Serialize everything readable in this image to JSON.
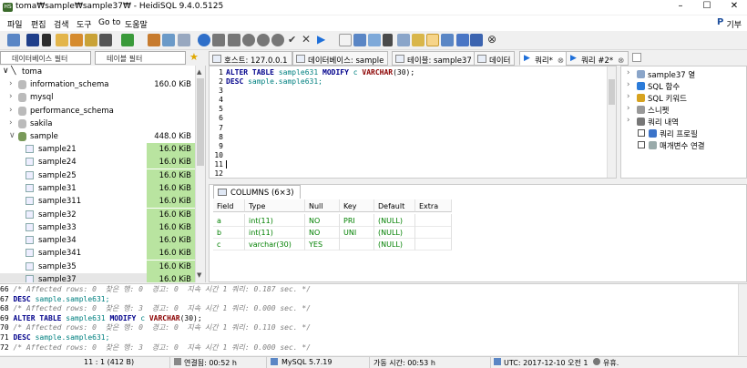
{
  "window": {
    "title": "toma₩sample₩sample37₩ - HeidiSQL 9.4.0.5125"
  },
  "menu": {
    "items": [
      "파일",
      "편집",
      "검색",
      "도구",
      "Go to",
      "도움말"
    ],
    "donate": "기부"
  },
  "filters": {
    "db_placeholder": "데이터베이스 필터",
    "table_placeholder": "테이블 필터"
  },
  "tabs": [
    "호스트: 127.0.0.1",
    "데이터베이스: sample",
    "테이블: sample37",
    "데이터",
    "쿼리*",
    "쿼리 #2*"
  ],
  "tree": {
    "root": "toma",
    "databases": [
      {
        "name": "information_schema",
        "size": "160.0 KiB"
      },
      {
        "name": "mysql",
        "size": ""
      },
      {
        "name": "performance_schema",
        "size": ""
      },
      {
        "name": "sakila",
        "size": ""
      },
      {
        "name": "sample",
        "size": "448.0 KiB"
      }
    ],
    "tables": [
      {
        "name": "sample21",
        "size": "16.0 KiB"
      },
      {
        "name": "sample24",
        "size": "16.0 KiB"
      },
      {
        "name": "sample25",
        "size": "16.0 KiB"
      },
      {
        "name": "sample31",
        "size": "16.0 KiB"
      },
      {
        "name": "sample311",
        "size": "16.0 KiB"
      },
      {
        "name": "sample32",
        "size": "16.0 KiB"
      },
      {
        "name": "sample33",
        "size": "16.0 KiB"
      },
      {
        "name": "sample34",
        "size": "16.0 KiB"
      },
      {
        "name": "sample341",
        "size": "16.0 KiB"
      },
      {
        "name": "sample35",
        "size": "16.0 KiB"
      },
      {
        "name": "sample37",
        "size": "16.0 KiB"
      }
    ]
  },
  "editor": {
    "line_numbers": [
      "1",
      "2",
      "3",
      "4",
      "5",
      "6",
      "7",
      "8",
      "9",
      "10",
      "11",
      "12"
    ],
    "line1": {
      "kw1": "ALTER TABLE",
      "ident": "sample631",
      "kw2": "MODIFY",
      "col": "c",
      "type": "VARCHAR",
      "arg": "(30);"
    },
    "line2": {
      "kw": "DESC",
      "ident": "sample.sample631;"
    }
  },
  "helper": {
    "items": [
      "sample37 열",
      "SQL 함수",
      "SQL 키워드",
      "스니펫",
      "쿼리 내역",
      "쿼리 프로필",
      "매개변수 연결"
    ]
  },
  "results": {
    "tab_label": "COLUMNS (6×3)",
    "headers": [
      "Field",
      "Type",
      "Null",
      "Key",
      "Default",
      "Extra"
    ],
    "rows": [
      [
        "a",
        "int(11)",
        "NO",
        "PRI",
        "(NULL)",
        ""
      ],
      [
        "b",
        "int(11)",
        "NO",
        "UNI",
        "(NULL)",
        ""
      ],
      [
        "c",
        "varchar(30)",
        "YES",
        "",
        "(NULL)",
        ""
      ]
    ]
  },
  "log": {
    "lines": [
      {
        "n": "66",
        "type": "comment",
        "text": "/* Affected rows: 0  찾은 행: 0  경고: 0  지속 시간 1 쿼리: 0.187 sec. */"
      },
      {
        "n": "67",
        "type": "sql",
        "kw": "DESC",
        "rest": "sample.sample631;"
      },
      {
        "n": "68",
        "type": "comment",
        "text": "/* Affected rows: 0  찾은 행: 3  경고: 0  지속 시간 1 쿼리: 0.000 sec. */"
      },
      {
        "n": "69",
        "type": "alter",
        "kw": "ALTER TABLE",
        "ident": "sample631",
        "kw2": "MODIFY",
        "col": "c",
        "fn": "VARCHAR",
        "arg": "(30);"
      },
      {
        "n": "70",
        "type": "comment",
        "text": "/* Affected rows: 0  찾은 행: 0  경고: 0  지속 시간 1 쿼리: 0.110 sec. */"
      },
      {
        "n": "71",
        "type": "sql",
        "kw": "DESC",
        "rest": "sample.sample631;"
      },
      {
        "n": "72",
        "type": "comment",
        "text": "/* Affected rows: 0  찾은 행: 3  경고: 0  지속 시간 1 쿼리: 0.000 sec. */"
      }
    ]
  },
  "status": {
    "pos": "11 : 1 (412 B)",
    "connected": "연결됨: 00:52 h",
    "server": "MySQL 5.7.19",
    "uptime": "가동 시간: 00:53 h",
    "time": "UTC: 2017-12-10 오전 1:45",
    "idle": "유휴."
  },
  "colors": {
    "size_bar": "#b9e4a0",
    "keyword": "#00008b",
    "comment": "#808080",
    "accent": "#1e6fd9"
  }
}
